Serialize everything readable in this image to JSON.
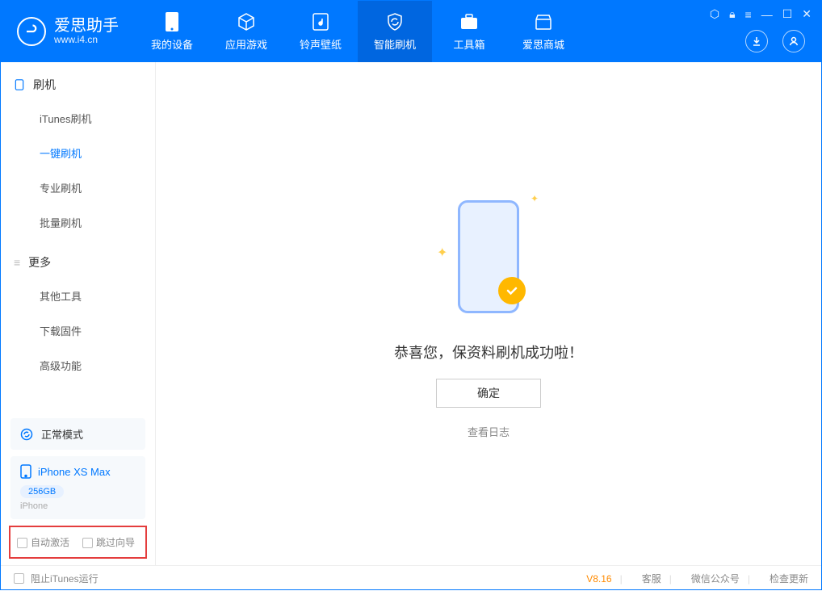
{
  "colors": {
    "accent": "#0078ff",
    "warn": "#ff8a00",
    "highlight_border": "#e43d3d"
  },
  "app": {
    "name": "爱思助手",
    "url": "www.i4.cn"
  },
  "nav": {
    "items": [
      {
        "label": "我的设备"
      },
      {
        "label": "应用游戏"
      },
      {
        "label": "铃声壁纸"
      },
      {
        "label": "智能刷机",
        "active": true
      },
      {
        "label": "工具箱"
      },
      {
        "label": "爱思商城"
      }
    ]
  },
  "sidebar": {
    "section1": {
      "title": "刷机",
      "items": [
        "iTunes刷机",
        "一键刷机",
        "专业刷机",
        "批量刷机"
      ],
      "active_index": 1
    },
    "section2": {
      "title": "更多",
      "items": [
        "其他工具",
        "下载固件",
        "高级功能"
      ]
    }
  },
  "device": {
    "mode": "正常模式",
    "name": "iPhone XS Max",
    "capacity": "256GB",
    "type": "iPhone"
  },
  "options": {
    "opt1": "自动激活",
    "opt2": "跳过向导"
  },
  "main": {
    "success_text": "恭喜您，保资料刷机成功啦！",
    "ok_button": "确定",
    "view_log": "查看日志"
  },
  "footer": {
    "block_itunes": "阻止iTunes运行",
    "version": "V8.16",
    "links": [
      "客服",
      "微信公众号",
      "检查更新"
    ]
  }
}
